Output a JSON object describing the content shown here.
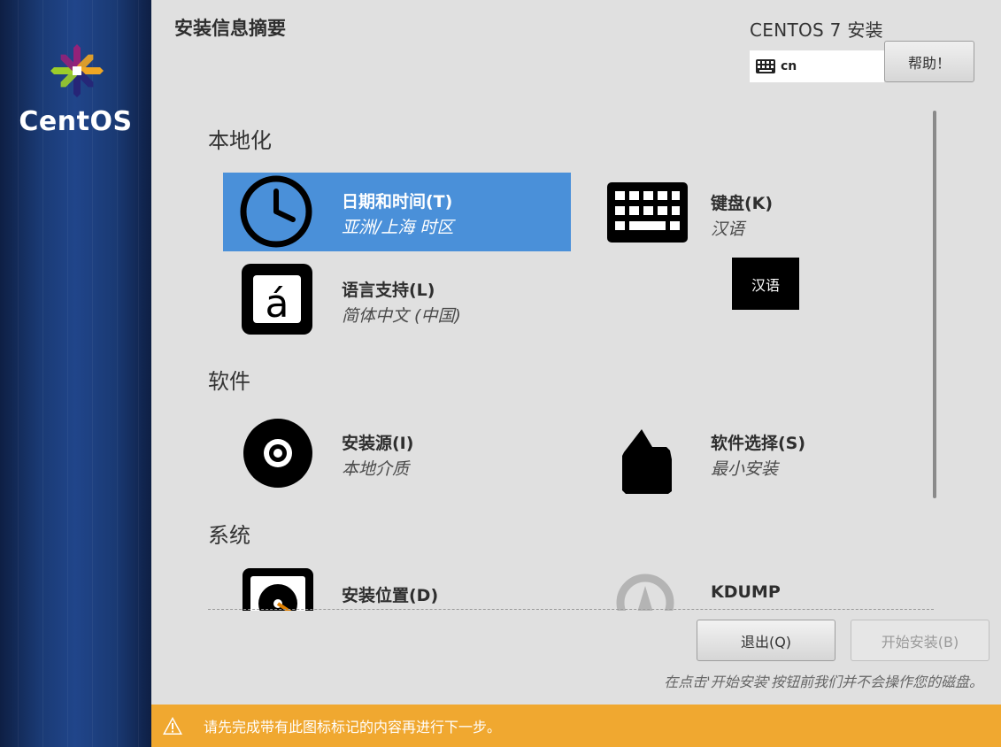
{
  "sidebar": {
    "brand": "CentOS"
  },
  "header": {
    "page_title": "安装信息摘要",
    "product_title": "CENTOS 7 安装",
    "keyboard_layout": "cn",
    "help_label": "帮助！"
  },
  "sections": [
    {
      "title": "本地化",
      "spokes": [
        {
          "label": "日期和时间(T)",
          "status": "亚洲/上海 时区",
          "icon": "clock-icon",
          "selected": true
        },
        {
          "label": "键盘(K)",
          "status": "汉语",
          "icon": "keyboard-icon"
        },
        {
          "label": "语言支持(L)",
          "status": "简体中文 (中国)",
          "icon": "language-icon"
        }
      ]
    },
    {
      "title": "软件",
      "spokes": [
        {
          "label": "安装源(I)",
          "status": "本地介质",
          "icon": "disc-icon"
        },
        {
          "label": "软件选择(S)",
          "status": "最小安装",
          "icon": "package-icon"
        }
      ]
    },
    {
      "title": "系统",
      "spokes": [
        {
          "label": "安装位置(D)",
          "icon": "harddisk-icon"
        },
        {
          "label": "KDUMP",
          "icon": "kdump-icon"
        }
      ]
    }
  ],
  "tooltip": "汉语",
  "buttons": {
    "quit": "退出(Q)",
    "begin": "开始安装(B)"
  },
  "note": "在点击'开始安装'按钮前我们并不会操作您的磁盘。",
  "warning": "请先完成带有此图标标记的内容再进行下一步。",
  "colors": {
    "selected": "#4a90d9",
    "warning_bar": "#f0a830",
    "sidebar": "#1a3a74"
  }
}
